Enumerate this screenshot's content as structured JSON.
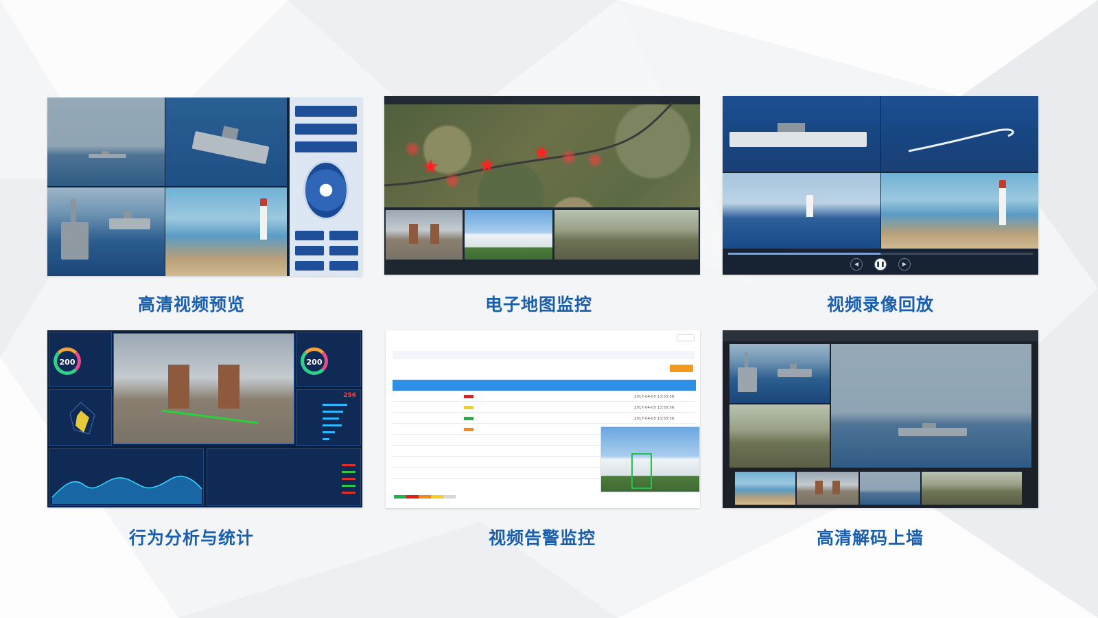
{
  "captions": {
    "hd_preview": "高清视频预览",
    "emap": "电子地图监控",
    "playback": "视频录像回放",
    "behavior": "行为分析与统计",
    "alarm": "视频告警监控",
    "decode_wall": "高清解码上墙"
  },
  "dashboard": {
    "ring_value_1": "200",
    "ring_value_2": "200",
    "alarm_count": "256"
  },
  "alarm_panel": {
    "timestamps": [
      "2017-04-05 13:55:56",
      "2017-04-05 13:55:56",
      "2017-04-05 13:55:56"
    ]
  },
  "colors": {
    "caption": "#1a5fae",
    "alarm_red": "#e02020",
    "alarm_yellow": "#f2d021",
    "alarm_green": "#22b24c",
    "alarm_orange": "#f08a1c",
    "table_header": "#2f8fe6"
  },
  "icons": [
    "star-marker-icon",
    "play-pause-icon",
    "ptz-joystick-icon"
  ]
}
